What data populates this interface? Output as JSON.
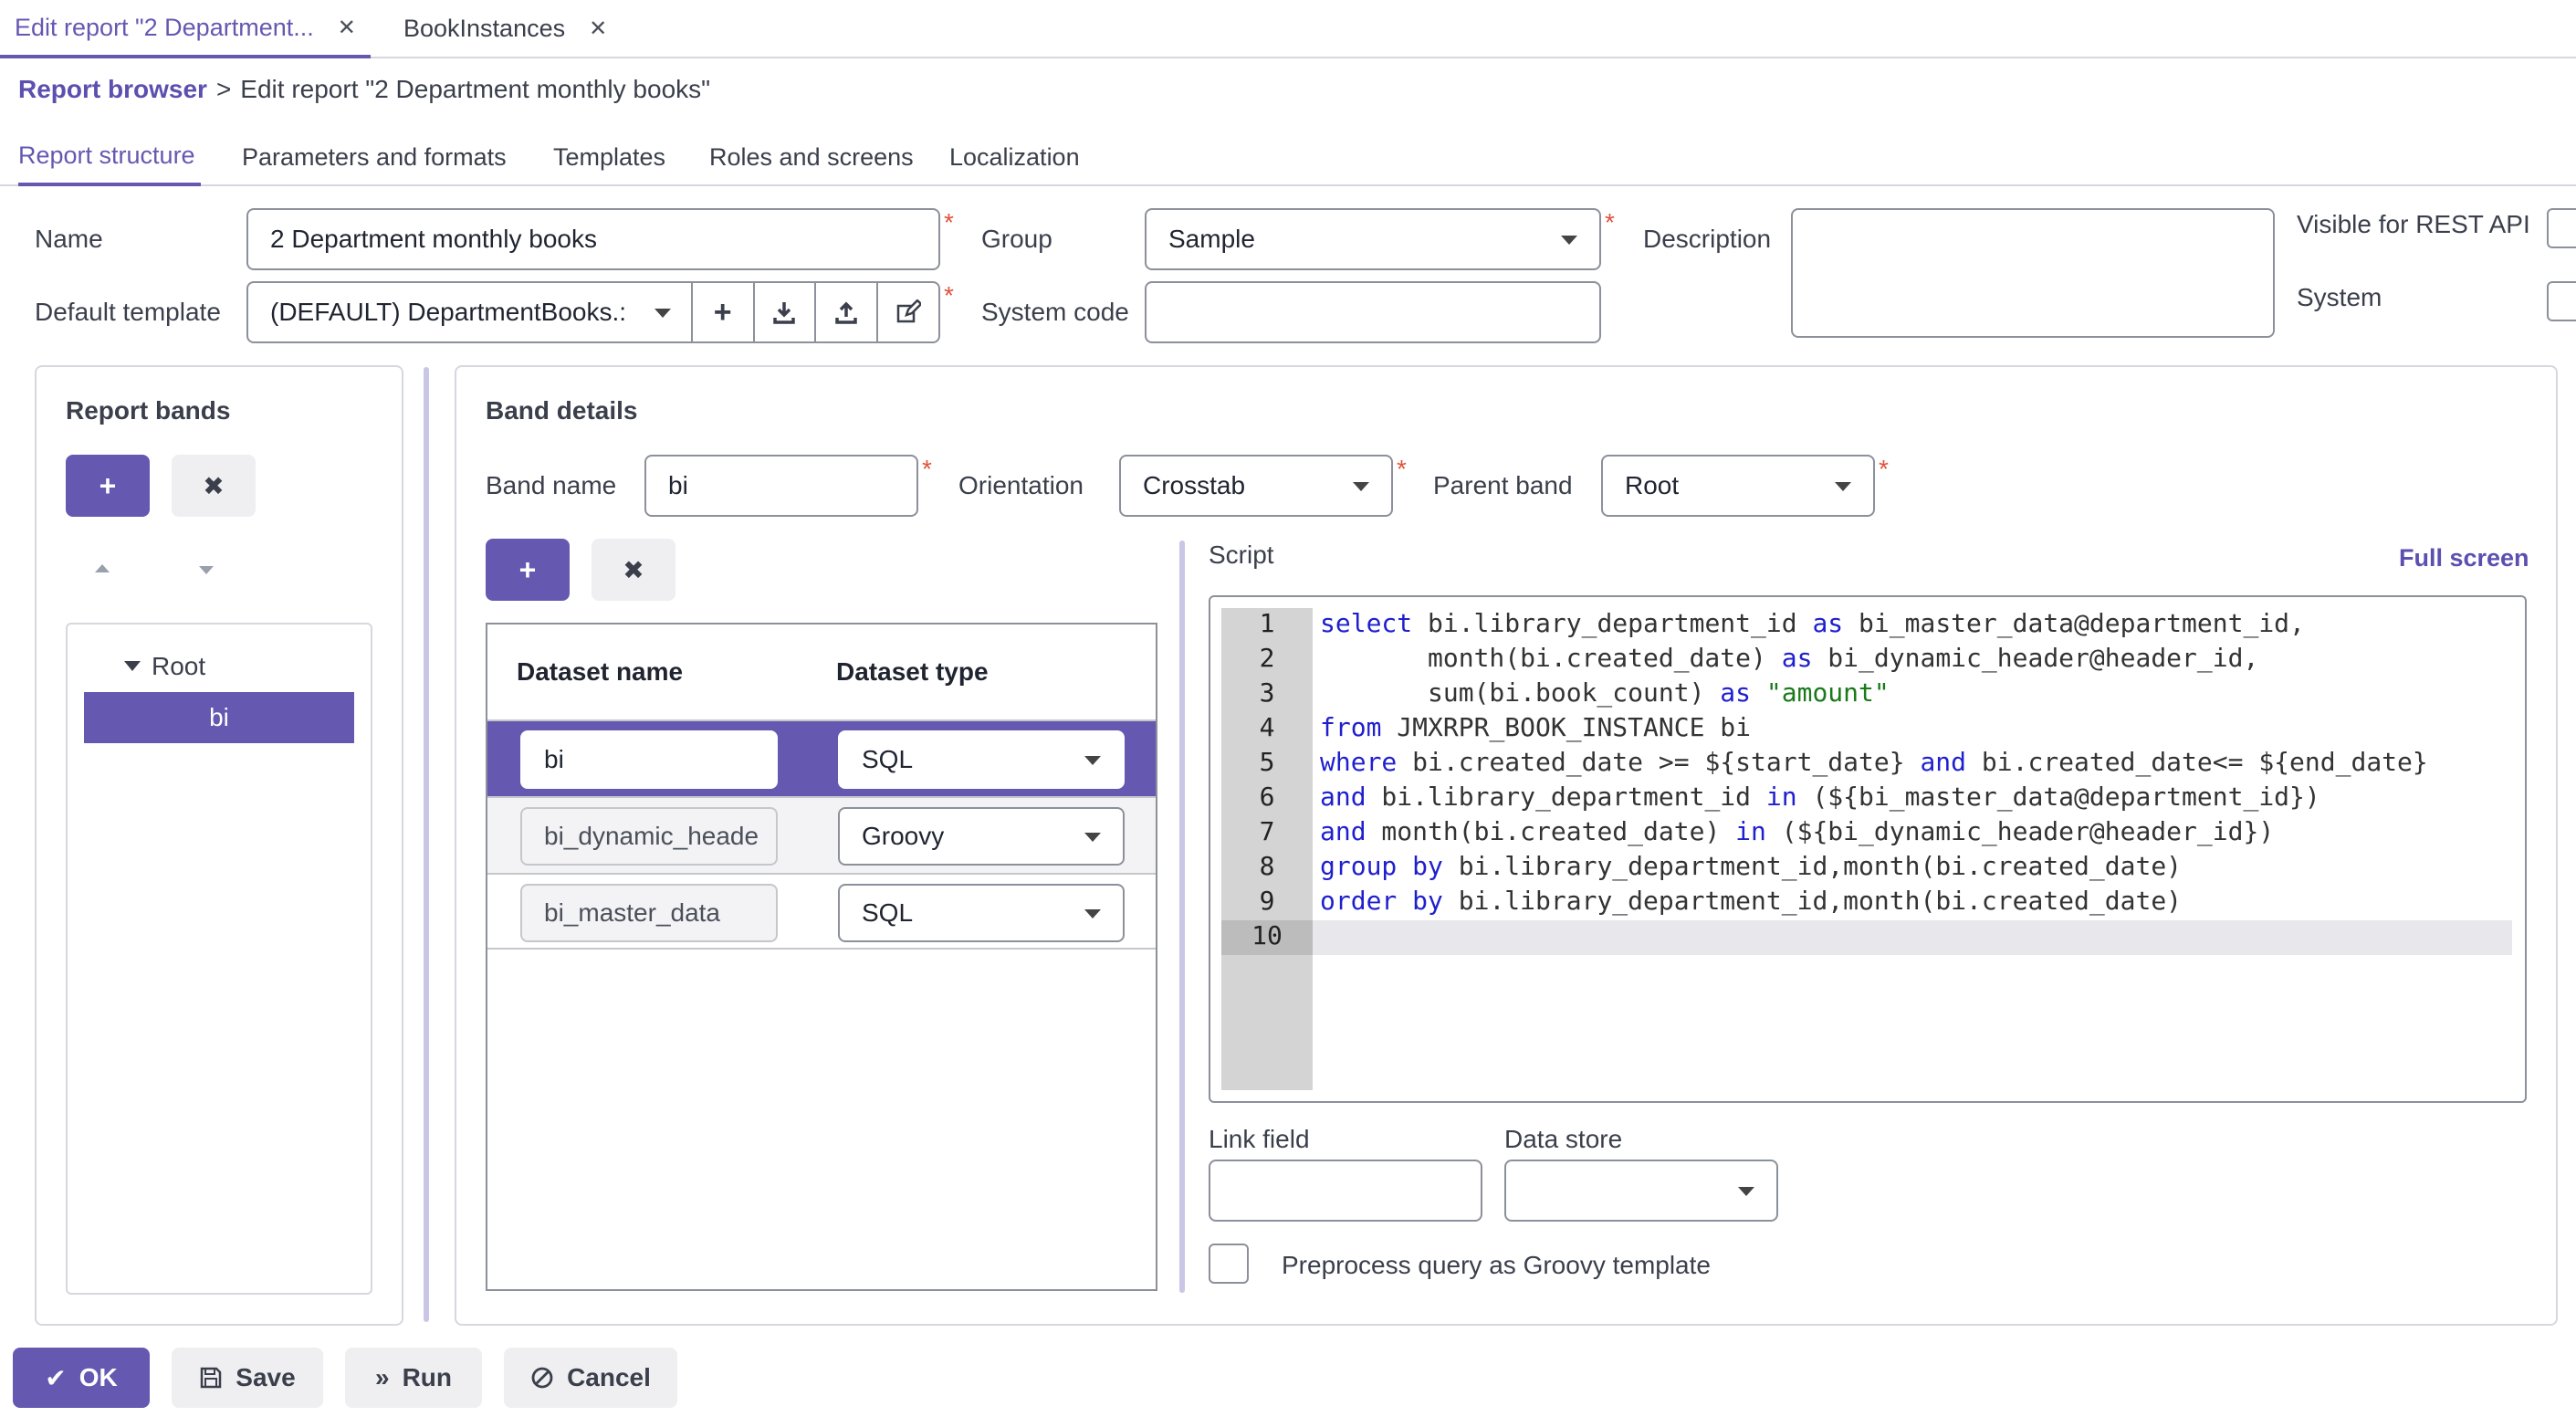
{
  "window_tabs": [
    {
      "label": "Edit report \"2 Department...",
      "active": true
    },
    {
      "label": "BookInstances",
      "active": false
    }
  ],
  "breadcrumb": {
    "root": "Report browser",
    "separator": ">",
    "current": "Edit report \"2 Department monthly books\""
  },
  "tabs": [
    "Report structure",
    "Parameters and formats",
    "Templates",
    "Roles and screens",
    "Localization"
  ],
  "form": {
    "name_label": "Name",
    "name_value": "2 Department monthly books",
    "group_label": "Group",
    "group_value": "Sample",
    "description_label": "Description",
    "description_value": "",
    "visible_rest_label": "Visible for REST API",
    "default_template_label": "Default template",
    "default_template_value": "(DEFAULT) DepartmentBooks.:",
    "system_code_label": "System code",
    "system_code_value": "",
    "system_label": "System",
    "required_mark": "*"
  },
  "report_bands": {
    "title": "Report bands",
    "tree": {
      "root": "Root",
      "child": "bi"
    }
  },
  "band_details": {
    "title": "Band details",
    "band_name_label": "Band name",
    "band_name_value": "bi",
    "orientation_label": "Orientation",
    "orientation_value": "Crosstab",
    "parent_band_label": "Parent band",
    "parent_band_value": "Root",
    "datasets": {
      "columns": [
        "Dataset name",
        "Dataset type"
      ],
      "rows": [
        {
          "name": "bi",
          "type": "SQL",
          "selected": true
        },
        {
          "name": "bi_dynamic_heade",
          "type": "Groovy",
          "selected": false
        },
        {
          "name": "bi_master_data",
          "type": "SQL",
          "selected": false
        }
      ]
    },
    "script_label": "Script",
    "full_screen_label": "Full screen",
    "script_line_numbers": [
      "1",
      "2",
      "3",
      "4",
      "5",
      "6",
      "7",
      "8",
      "9",
      "10"
    ],
    "script_lines": [
      "select bi.library_department_id as bi_master_data@department_id,",
      "       month(bi.created_date) as bi_dynamic_header@header_id,",
      "       sum(bi.book_count) as \"amount\"",
      "from JMXRPR_BOOK_INSTANCE bi",
      "where bi.created_date >= ${start_date} and bi.created_date<= ${end_date}",
      "and bi.library_department_id in (${bi_master_data@department_id})",
      "and month(bi.created_date) in (${bi_dynamic_header@header_id})",
      "group by bi.library_department_id,month(bi.created_date)",
      "order by bi.library_department_id,month(bi.created_date)",
      ""
    ],
    "link_field_label": "Link field",
    "link_field_value": "",
    "data_store_label": "Data store",
    "data_store_value": "",
    "preprocess_label": "Preprocess query as Groovy template"
  },
  "footer": {
    "ok": "OK",
    "save": "Save",
    "run": "Run",
    "cancel": "Cancel"
  },
  "colors": {
    "accent": "#6558b1",
    "required": "#e0533d",
    "keyword": "#1f1fcf",
    "string": "#1a7a1a"
  }
}
